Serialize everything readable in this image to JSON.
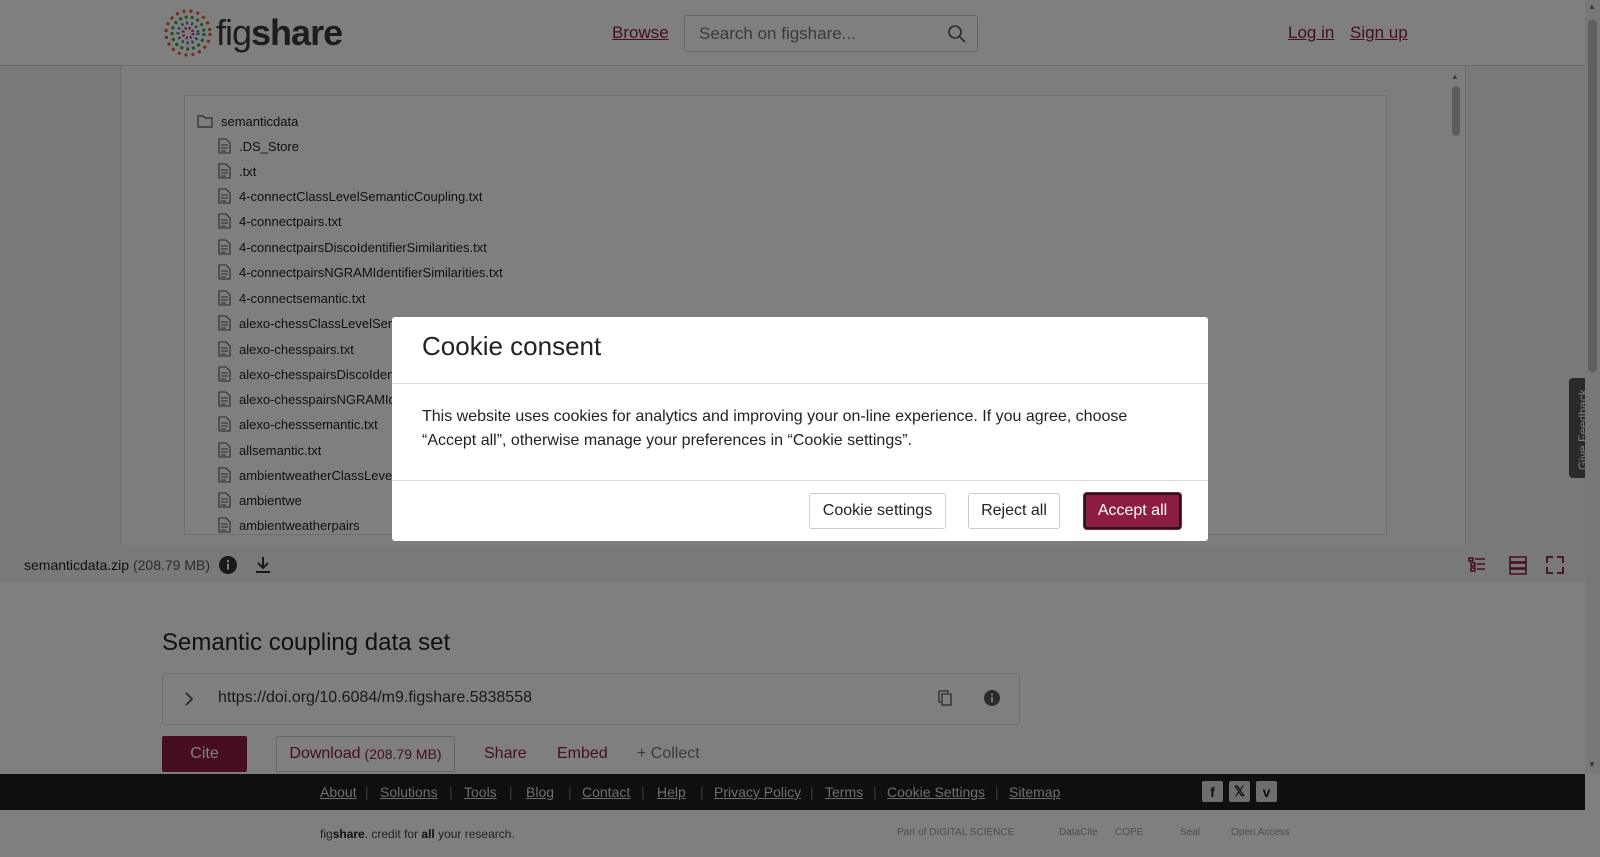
{
  "header": {
    "logo_text_a": "fig",
    "logo_text_b": "share",
    "browse": "Browse",
    "search_placeholder": "Search on figshare...",
    "login": "Log in",
    "signup": "Sign up"
  },
  "viewer": {
    "root_folder": "semanticdata",
    "files": [
      ".DS_Store",
      ".txt",
      "4-connectClassLevelSemanticCoupling.txt",
      "4-connectpairs.txt",
      "4-connectpairsDiscoIdentifierSimilarities.txt",
      "4-connectpairsNGRAMIdentifierSimilarities.txt",
      "4-connectsemantic.txt",
      "alexo-chessClassLevelSem",
      "alexo-chesspairs.txt",
      "alexo-chesspairsDiscoIden",
      "alexo-chesspairsNGRAMId",
      "alexo-chesssemantic.txt",
      "allsemantic.txt",
      "ambientweatherClassLevel",
      "ambientwe",
      "ambientweatherpairs"
    ],
    "file_name": "semanticdata.zip",
    "file_size": "(208.79 MB)"
  },
  "item": {
    "title": "Semantic coupling data set",
    "doi": "https://doi.org/10.6084/m9.figshare.5838558",
    "cite": "Cite",
    "download": "Download",
    "download_size": "(208.79 MB)",
    "share": "Share",
    "embed": "Embed",
    "collect": "+ Collect"
  },
  "footer": {
    "links": [
      "About",
      "Solutions",
      "Tools",
      "Blog",
      "Contact",
      "Help",
      "Privacy Policy",
      "Terms",
      "Cookie Settings",
      "Sitemap"
    ],
    "tagline_a": "fig",
    "tagline_b": "share",
    "tagline_c": ". credit for ",
    "tagline_d": "all",
    "tagline_e": " your research.",
    "partners": [
      "Part of DIGITAL SCIENCE",
      "DataCite",
      "COPE",
      "Seal",
      "Open Access"
    ],
    "social": [
      "facebook-icon",
      "x-icon",
      "vimeo-icon"
    ]
  },
  "feedback": "Give Feedback",
  "cookie": {
    "title": "Cookie consent",
    "body": "This website uses cookies for analytics and improving your on-line experience. If you agree, choose “Accept all”, otherwise manage your preferences in “Cookie settings”.",
    "settings": "Cookie settings",
    "reject": "Reject all",
    "accept": "Accept all"
  },
  "colors": {
    "brand": "#8c1d40",
    "footer_bg": "#1f1f1f"
  }
}
